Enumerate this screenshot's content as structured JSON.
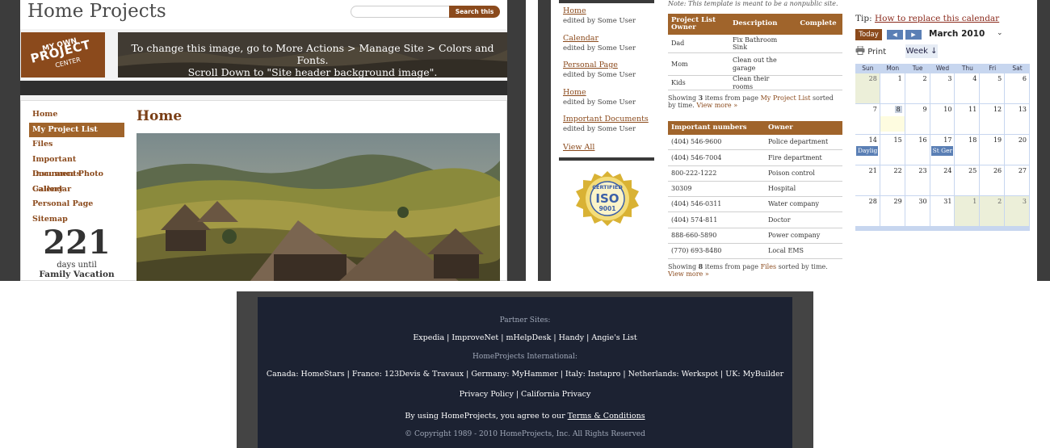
{
  "panel1": {
    "site_title": "Home Projects",
    "search_button": "Search this site",
    "logo": {
      "line1": "MY OWN",
      "line2": "PROJECT",
      "line3": "CENTER"
    },
    "banner_text_1": "To change this image, go to More Actions > Manage Site > Colors and Fonts.",
    "banner_text_2": "Scroll Down to \"Site header background image\".",
    "nav": [
      "Home",
      "My Project List",
      "Files",
      "Important Documents",
      "Insurance Photo Gallery",
      "Calendar",
      "Personal Page",
      "Sitemap"
    ],
    "active_nav": "My Project List",
    "countdown": {
      "number": "221",
      "label": "days until",
      "event": "Family Vacation"
    },
    "page_heading": "Home"
  },
  "panel2": {
    "recent_items": [
      {
        "title": "Home",
        "by": "edited by Some User"
      },
      {
        "title": "Calendar",
        "by": "edited by Some User"
      },
      {
        "title": "Personal Page",
        "by": "edited by Some User"
      },
      {
        "title": "Home",
        "by": "edited by Some User"
      },
      {
        "title": "Important Documents",
        "by": "edited by Some User"
      }
    ],
    "view_all": "View All",
    "seal": {
      "top": "CERTIFIED",
      "mid": "ISO",
      "bottom": "9001"
    },
    "note": "Note: This template is meant to be a nonpublic site.",
    "projects": {
      "headers": [
        "Project List Owner",
        "Description",
        "Complete"
      ],
      "rows": [
        [
          "Dad",
          "Fix Bathroom Sink",
          ""
        ],
        [
          "Mom",
          "Clean out the garage",
          ""
        ],
        [
          "Kids",
          "Clean their rooms",
          ""
        ]
      ],
      "showing_pre": "Showing ",
      "showing_count": "3",
      "showing_mid": " items from page ",
      "showing_link": "My Project List",
      "showing_post": " sorted by time. ",
      "view_more": "View more »"
    },
    "numbers": {
      "headers": [
        "Important numbers",
        "Owner"
      ],
      "rows": [
        [
          "(404) 546-9600",
          "Police department"
        ],
        [
          "(404) 546-7004",
          "Fire department"
        ],
        [
          "800-222-1222",
          "Poison control"
        ],
        [
          "30309",
          "Hospital"
        ],
        [
          "(404) 546-0311",
          "Water company"
        ],
        [
          "(404) 574-811",
          "Doctor"
        ],
        [
          "888-660-5890",
          "Power company"
        ],
        [
          "(770) 693-8480",
          "Local EMS"
        ]
      ],
      "showing_pre": "Showing ",
      "showing_count": "8",
      "showing_mid": " items from page ",
      "showing_link": "Files",
      "showing_post": " sorted by time. ",
      "view_more": "View more »"
    },
    "tip_label": "Tip: ",
    "tip_link": "How to replace this calendar",
    "calendar": {
      "today_btn": "Today",
      "prev": "◀",
      "next": "▶",
      "month": "March 2010",
      "dropdown": "⌄",
      "print": "Print",
      "week": "Week ↓",
      "weekdays": [
        "Sun",
        "Mon",
        "Tue",
        "Wed",
        "Thu",
        "Fri",
        "Sat"
      ],
      "weeks": [
        [
          {
            "d": "28",
            "o": true
          },
          {
            "d": "1"
          },
          {
            "d": "2"
          },
          {
            "d": "3"
          },
          {
            "d": "4"
          },
          {
            "d": "5"
          },
          {
            "d": "6"
          }
        ],
        [
          {
            "d": "7"
          },
          {
            "d": "8",
            "today": true
          },
          {
            "d": "9"
          },
          {
            "d": "10"
          },
          {
            "d": "11"
          },
          {
            "d": "12"
          },
          {
            "d": "13"
          }
        ],
        [
          {
            "d": "14",
            "evt": "Daylig"
          },
          {
            "d": "15"
          },
          {
            "d": "16"
          },
          {
            "d": "17",
            "evt": "St Ger"
          },
          {
            "d": "18"
          },
          {
            "d": "19"
          },
          {
            "d": "20"
          }
        ],
        [
          {
            "d": "21"
          },
          {
            "d": "22"
          },
          {
            "d": "23"
          },
          {
            "d": "24"
          },
          {
            "d": "25"
          },
          {
            "d": "26"
          },
          {
            "d": "27"
          }
        ],
        [
          {
            "d": "28"
          },
          {
            "d": "29"
          },
          {
            "d": "30"
          },
          {
            "d": "31"
          },
          {
            "d": "1",
            "o": true
          },
          {
            "d": "2",
            "o": true
          },
          {
            "d": "3",
            "o": true
          }
        ]
      ]
    }
  },
  "panel3": {
    "partner_label": "Partner Sites:",
    "partners": "Expedia | ImproveNet | mHelpDesk | Handy | Angie's List",
    "intl_label": "HomeProjects International:",
    "intl": "Canada: HomeStars | France: 123Devis & Travaux | Germany: MyHammer | Italy: Instapro | Netherlands: Werkspot | UK: MyBuilder",
    "policy": "Privacy Policy | California Privacy",
    "terms_pre": "By using HomeProjects, you agree to our ",
    "terms_link": "Terms & Conditions",
    "copyright": "© Copyright 1989 - 2010 HomeProjects, Inc. All Rights Reserved"
  }
}
